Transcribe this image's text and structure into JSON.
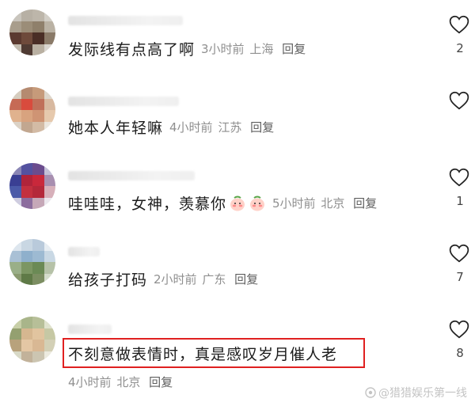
{
  "comments": [
    {
      "text": "发际线有点高了啊",
      "time": "3小时前",
      "location": "上海",
      "reply": "回复",
      "likes": "2"
    },
    {
      "text": "她本人年轻嘛",
      "time": "4小时前",
      "location": "江苏",
      "reply": "回复",
      "likes": ""
    },
    {
      "text": "哇哇哇，女神，羡慕你",
      "time": "5小时前",
      "location": "北京",
      "reply": "回复",
      "likes": "1",
      "emojis": [
        "peach-emoji",
        "peach-emoji"
      ]
    },
    {
      "text": "给孩子打码",
      "time": "2小时前",
      "location": "广东",
      "reply": "回复",
      "likes": "7"
    },
    {
      "text": "不刻意做表情时，真是感叹岁月催人老",
      "time": "4小时前",
      "location": "北京",
      "reply": "回复",
      "likes": "8",
      "highlighted": true
    }
  ],
  "watermark": "@猎猎娱乐第一线",
  "colors": {
    "highlight": "#e02020",
    "meta": "#8f8f8f",
    "text": "#1b1b1b"
  }
}
